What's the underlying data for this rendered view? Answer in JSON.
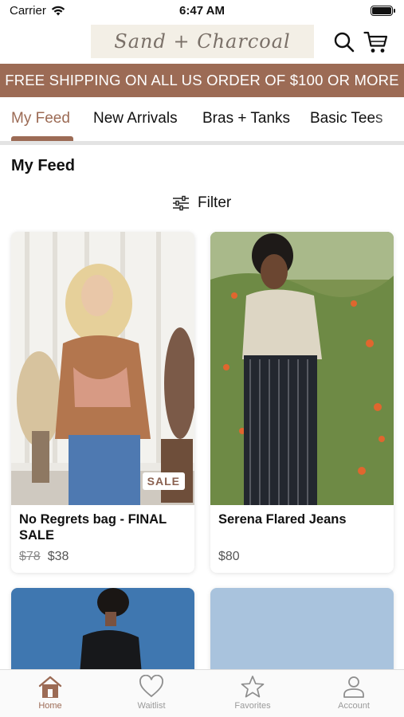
{
  "status": {
    "carrier": "Carrier",
    "time": "6:47 AM"
  },
  "header": {
    "logo_text": "Sand + Charcoal"
  },
  "promo": {
    "text": "FREE SHIPPING ON ALL US ORDER OF $100 OR MORE"
  },
  "tabs": [
    {
      "label": "My Feed",
      "active": true
    },
    {
      "label": "New Arrivals",
      "active": false
    },
    {
      "label": "Bras + Tanks",
      "active": false
    },
    {
      "label": "Basic Tees",
      "active": false
    }
  ],
  "feed": {
    "title": "My Feed",
    "filter_label": "Filter",
    "products": [
      {
        "name": "No Regrets bag - FINAL SALE",
        "old_price": "$78",
        "price": "$38",
        "badge": "SALE"
      },
      {
        "name": "Serena Flared Jeans",
        "price": "$80"
      }
    ]
  },
  "bottom_nav": [
    {
      "label": "Home",
      "icon": "home-icon",
      "active": true
    },
    {
      "label": "Waitlist",
      "icon": "heart-icon",
      "active": false
    },
    {
      "label": "Favorites",
      "icon": "star-icon",
      "active": false
    },
    {
      "label": "Account",
      "icon": "person-icon",
      "active": false
    }
  ],
  "colors": {
    "accent": "#9c6b55",
    "banner": "#9c6b55",
    "logo_bg": "#f3efe6"
  }
}
